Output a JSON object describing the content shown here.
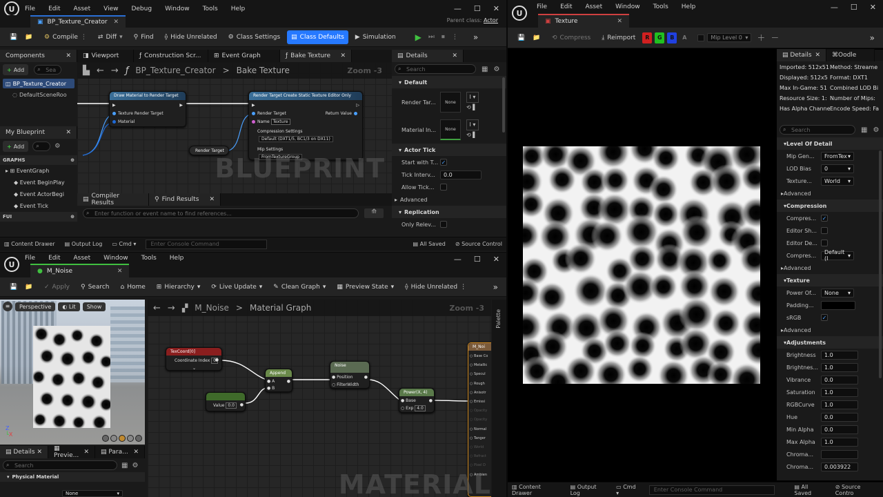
{
  "bp_window": {
    "menu": [
      "File",
      "Edit",
      "Asset",
      "View",
      "Debug",
      "Window",
      "Tools",
      "Help"
    ],
    "tab": "BP_Texture_Creator",
    "parent_class_label": "Parent class:",
    "parent_class_value": "Actor",
    "toolbar": {
      "compile": "Compile",
      "diff": "Diff",
      "find": "Find",
      "hide_unrelated": "Hide Unrelated",
      "class_settings": "Class Settings",
      "class_defaults": "Class Defaults",
      "simulation": "Simulation"
    },
    "components": {
      "title": "Components",
      "add": "Add",
      "search_placeholder": "Sea",
      "root": "BP_Texture_Creator",
      "child": "DefaultSceneRoo"
    },
    "my_blueprint": {
      "title": "My Blueprint",
      "add": "Add",
      "graphs_label": "GRAPHS",
      "event_graph": "EventGraph",
      "events": [
        "Event BeginPlay",
        "Event ActorBegi",
        "Event Tick"
      ],
      "functions_label": "FUI"
    },
    "graph_tabs": [
      "Viewport",
      "Construction Scr...",
      "Event Graph",
      "Bake Texture"
    ],
    "breadcrumb": {
      "root": "BP_Texture_Creator",
      "current": "Bake Texture",
      "zoom": "Zoom -3"
    },
    "watermark": "BLUEPRINT",
    "nodes": {
      "draw_title": "Draw Material to Render Target",
      "draw_pins": [
        "Texture Render Target",
        "Material"
      ],
      "rt_var": "Render Target",
      "create_title": "Render Target Create Static Texture Editor Only",
      "create_pins": [
        "Render Target",
        "Name",
        "Return Value"
      ],
      "name_value": "Texture",
      "compression_label": "Compression Settings",
      "compression_value": "Default (DXT1/5, BC1/3 on DX11)",
      "mip_label": "Mip Settings",
      "mip_value": "FromTextureGroup"
    },
    "results_tabs": [
      "Compiler Results",
      "Find Results"
    ],
    "results_search_placeholder": "Enter function or event name to find references...",
    "details": {
      "title": "Details",
      "search_placeholder": "Search",
      "default_section": "Default",
      "render_target_label": "Render Tar...",
      "material_label": "Material In...",
      "none": "None",
      "actor_tick_section": "Actor Tick",
      "start_with_tick": "Start with T...",
      "tick_interval": "Tick Interv...",
      "tick_interval_value": "0.0",
      "allow_tick": "Allow Tick...",
      "advanced": "Advanced",
      "replication_section": "Replication",
      "only_relevant": "Only Relev..."
    },
    "status": {
      "content_drawer": "Content Drawer",
      "output_log": "Output Log",
      "cmd": "Cmd",
      "console_placeholder": "Enter Console Command",
      "all_saved": "All Saved",
      "source_control": "Source Control"
    }
  },
  "mat_window": {
    "menu": [
      "File",
      "Edit",
      "Asset",
      "Window",
      "Tools",
      "Help"
    ],
    "tab": "M_Noise",
    "toolbar": {
      "apply": "Apply",
      "search": "Search",
      "home": "Home",
      "hierarchy": "Hierarchy",
      "live_update": "Live Update",
      "clean_graph": "Clean Graph",
      "preview_state": "Preview State",
      "hide_unrelated": "Hide Unrelated"
    },
    "viewport": {
      "perspective": "Perspective",
      "lit": "Lit",
      "show": "Show"
    },
    "breadcrumb": {
      "root": "M_Noise",
      "current": "Material Graph",
      "zoom": "Zoom -3"
    },
    "palette": "Palette",
    "watermark": "MATERIAL",
    "nodes": {
      "texcoord": "TexCoord[0]",
      "coord_index_label": "Coordinate Index",
      "coord_index_value": "0",
      "append": "Append",
      "append_pins": [
        "A",
        "B"
      ],
      "const_value_label": "Value",
      "const_value": "0.0",
      "noise": "Noise",
      "noise_pins": [
        "Position",
        "FilterWidth"
      ],
      "power": "Power(X, 4)",
      "power_pins": [
        "Base",
        "Exp"
      ],
      "exp_value": "4.0",
      "output": "M_Noi",
      "output_pins": [
        "Base Co",
        "Metallic",
        "Specul",
        "Rough",
        "Anisotr",
        "Emissi",
        "Opacity",
        "Opacity",
        "Normal",
        "Tanger",
        "World",
        "Refract",
        "Pixel D",
        "Ambien"
      ]
    },
    "details_tabs": [
      "Details",
      "Previe...",
      "Para..."
    ],
    "details_search_placeholder": "Search",
    "physical_material": "Physical Material",
    "none": "None"
  },
  "tex_window": {
    "menu": [
      "File",
      "Edit",
      "Asset",
      "Window",
      "Tools",
      "Help"
    ],
    "tab": "Texture",
    "toolbar": {
      "compress": "Compress",
      "reimport": "Reimport",
      "channels": [
        "R",
        "G",
        "B",
        "A"
      ],
      "mip": "Mip Level 0"
    },
    "info_tabs": [
      "Details",
      "Oodle"
    ],
    "info": [
      [
        "Imported: 512x51",
        "Method: Streame"
      ],
      [
        "Displayed: 512x5",
        "Format: DXT1"
      ],
      [
        "Max In-Game: 51",
        "Combined LOD Bi"
      ],
      [
        "Resource Size: 1:",
        "Number of Mips:"
      ],
      [
        "Has Alpha Channe",
        "Encode Speed: Fa"
      ]
    ],
    "search_placeholder": "Search",
    "sections": {
      "lod": "Level Of Detail",
      "compression": "Compression",
      "texture": "Texture",
      "adjustments": "Adjustments",
      "advanced": "Advanced"
    },
    "lod_rows": [
      [
        "Mip Gen...",
        "FromTex"
      ],
      [
        "LOD Bias",
        "0"
      ],
      [
        "Texture...",
        "World"
      ]
    ],
    "compression_rows": [
      [
        "Compres...",
        "check"
      ],
      [
        "Editor Sh...",
        "empty"
      ],
      [
        "Editor De...",
        "empty"
      ],
      [
        "Compres...",
        "Default (I"
      ]
    ],
    "texture_rows": [
      [
        "Power Of...",
        "None"
      ],
      [
        "Padding...",
        ""
      ],
      [
        "sRGB",
        "check"
      ]
    ],
    "adjust_rows": [
      [
        "Brightness",
        "1.0"
      ],
      [
        "Brightnes...",
        "1.0"
      ],
      [
        "Vibrance",
        "0.0"
      ],
      [
        "Saturation",
        "1.0"
      ],
      [
        "RGBCurve",
        "1.0"
      ],
      [
        "Hue",
        "0.0"
      ],
      [
        "Min Alpha",
        "0.0"
      ],
      [
        "Max Alpha",
        "1.0"
      ],
      [
        "Chroma...",
        ""
      ],
      [
        "Chroma...",
        "0.003922"
      ]
    ],
    "status": {
      "content_drawer": "Content Drawer",
      "output_log": "Output Log",
      "cmd": "Cmd",
      "console_placeholder": "Enter Console Command",
      "all_saved": "All Saved",
      "source_control": "Source Contro"
    }
  }
}
